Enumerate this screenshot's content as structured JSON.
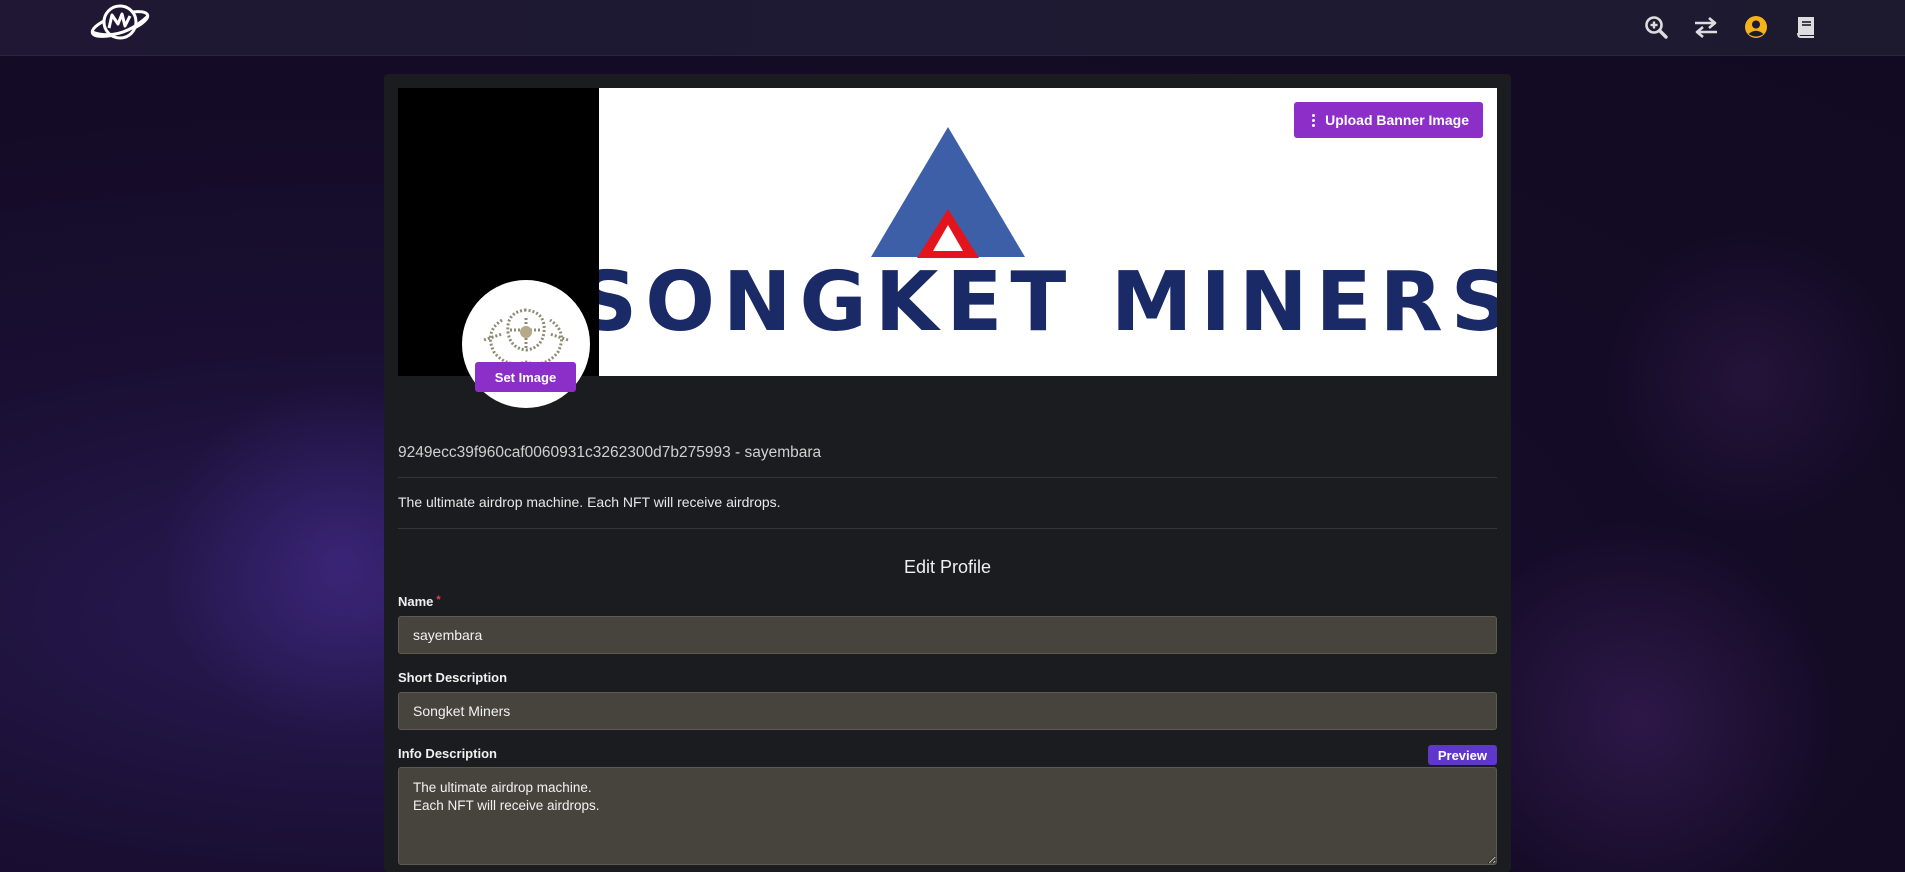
{
  "header": {
    "logo_icon": "planet-logo-icon",
    "icons": [
      "zoom-in-icon",
      "swap-arrows-icon",
      "user-account-icon",
      "book-icon"
    ],
    "accent_user_icon_color": "#f5b21a"
  },
  "banner": {
    "brand_text": "SONGKET MINERS",
    "upload_label": "Upload Banner Image"
  },
  "avatar": {
    "set_image_label": "Set Image"
  },
  "profile": {
    "id_line": "9249ecc39f960caf0060931c3262300d7b275993 - sayembara",
    "description": "The ultimate airdrop machine. Each NFT will receive airdrops."
  },
  "form": {
    "title": "Edit Profile",
    "name_label": "Name",
    "name_required": "*",
    "name_value": "sayembara",
    "short_desc_label": "Short Description",
    "short_desc_value": "Songket Miners",
    "info_desc_label": "Info Description",
    "preview_label": "Preview",
    "info_desc_value": "The ultimate airdrop machine.\nEach NFT will receive airdrops."
  },
  "colors": {
    "accent_purple": "#8c2fc9",
    "preview_purple": "#5f38c9",
    "brand_navy": "#1a2a66",
    "brand_blue": "#3d5fa8",
    "brand_red": "#e3141b"
  }
}
